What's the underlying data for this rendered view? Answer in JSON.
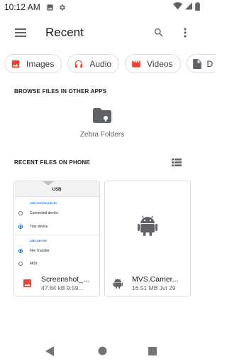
{
  "status_bar": {
    "time": "10:12 AM"
  },
  "app_bar": {
    "title": "Recent"
  },
  "chips": [
    {
      "label": "Images",
      "icon": "image-icon",
      "color": "#ea4335"
    },
    {
      "label": "Audio",
      "icon": "headphones-icon",
      "color": "#ea4335"
    },
    {
      "label": "Videos",
      "icon": "movie-icon",
      "color": "#ea4335"
    },
    {
      "label": "D",
      "icon": "document-icon",
      "color": "#5f6368"
    }
  ],
  "browse_section": {
    "title": "BROWSE FILES IN OTHER APPS",
    "apps": [
      {
        "label": "Zebra Folders",
        "icon": "folder-icon"
      }
    ]
  },
  "recent_section": {
    "title": "RECENT FILES ON PHONE"
  },
  "files": [
    {
      "name": "Screenshot_...",
      "meta": "47.84 kB 9:59...",
      "type_icon": "image-icon",
      "thumbnail": {
        "title": "USB",
        "section1": "USB CONTROLLED BY",
        "options1": [
          "Connected device",
          "This device"
        ],
        "section2": "USE USB FOR",
        "options2": [
          "File Transfer",
          "MIDI"
        ]
      }
    },
    {
      "name": "MVS.Camer...",
      "meta": "16.51 MB Jul 29",
      "type_icon": "android-icon"
    }
  ],
  "colors": {
    "accent": "#1a73e8",
    "image_red": "#ea4335",
    "icon_gray": "#5f6368"
  }
}
